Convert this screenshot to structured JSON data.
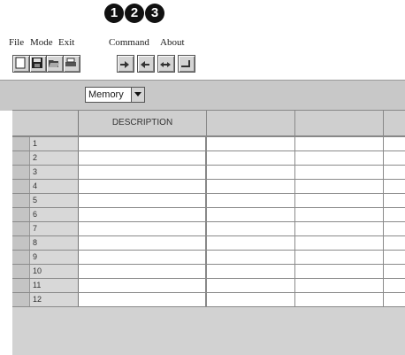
{
  "callouts": [
    "1",
    "2",
    "3"
  ],
  "menu": [
    "File",
    "Mode",
    "Exit",
    "Command",
    "About"
  ],
  "toolbar": {
    "buttons": [
      "new-icon",
      "save-icon",
      "open-icon",
      "print-icon",
      "command-first-icon",
      "command-last-icon",
      "command-both-icon",
      "command-end-icon"
    ]
  },
  "select": {
    "value": "Memory"
  },
  "grid": {
    "headers": [
      "",
      "DESCRIPTION",
      "",
      "",
      ""
    ],
    "row_numbers": [
      "1",
      "2",
      "3",
      "4",
      "5",
      "6",
      "7",
      "8",
      "9",
      "10",
      "11",
      "12"
    ]
  }
}
